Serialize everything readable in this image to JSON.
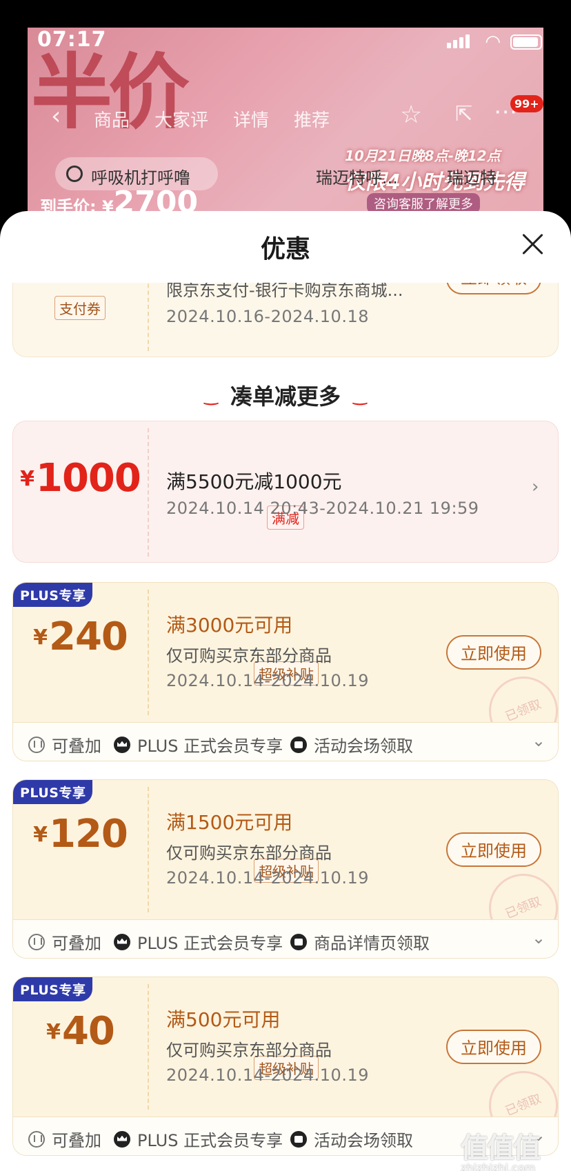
{
  "status_bar": {
    "time": "07:17"
  },
  "background": {
    "banner_text": "半价",
    "nav_tabs": [
      "商品",
      "大家评",
      "详情",
      "推荐"
    ],
    "badge": "99+",
    "search_placeholder": "呼吸机打呼噜",
    "search_hint_2": "瑞迈特呼...",
    "search_hint_3": "瑞迈特",
    "promo_line1": "10月21日晚8点-晚12点",
    "promo_line2": "仅限4小时先到先得",
    "consult": "咨询客服了解更多",
    "price_label": "到手价: ¥",
    "price_value": "2700"
  },
  "sheet": {
    "title": "优惠"
  },
  "pay_coupon": {
    "desc": "限京东支付-银行卡购京东商城...",
    "date": "2024.10.16-2024.10.18",
    "tag": "支付券",
    "button": "立即领取"
  },
  "section": {
    "title": "凑单减更多"
  },
  "man_jian": {
    "yen": "¥",
    "amount": "1000",
    "tag": "满减",
    "condition": "满5500元减1000元",
    "date": "2024.10.14 20:43-2024.10.21 19:59"
  },
  "plus_coupons": [
    {
      "badge": "PLUS专享",
      "yen": "¥",
      "amount": "240",
      "tag": "超级补贴",
      "condition": "满3000元可用",
      "desc": "仅可购买京东部分商品",
      "date": "2024.10.14-2024.10.19",
      "button": "立即使用",
      "stamp": "已领取",
      "features": [
        "可叠加",
        "PLUS 正式会员专享",
        "活动会场领取"
      ]
    },
    {
      "badge": "PLUS专享",
      "yen": "¥",
      "amount": "120",
      "tag": "超级补贴",
      "condition": "满1500元可用",
      "desc": "仅可购买京东部分商品",
      "date": "2024.10.14-2024.10.19",
      "button": "立即使用",
      "stamp": "已领取",
      "features": [
        "可叠加",
        "PLUS 正式会员专享",
        "商品详情页领取"
      ]
    },
    {
      "badge": "PLUS专享",
      "yen": "¥",
      "amount": "40",
      "tag": "超级补贴",
      "condition": "满500元可用",
      "desc": "仅可购买京东部分商品",
      "date": "2024.10.14-2024.10.19",
      "button": "立即使用",
      "stamp": "已领取",
      "features": [
        "可叠加",
        "PLUS 正式会员专享",
        "活动会场领取"
      ]
    }
  ],
  "watermark": {
    "text": "值值值",
    "url": "zhizhizhi.com"
  },
  "colors": {
    "accent_red": "#e2231a",
    "coupon_brown": "#b35a16",
    "plus_blue": "#2f3aa9"
  }
}
